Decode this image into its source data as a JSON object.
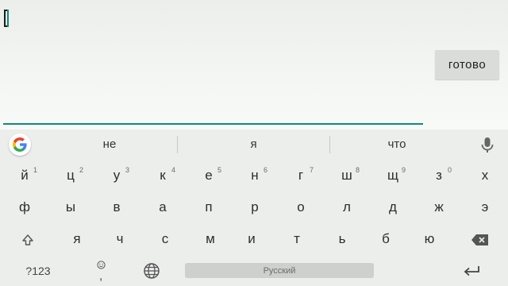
{
  "screen": {
    "done_label": "готово"
  },
  "keyboard": {
    "suggestions": [
      "не",
      "я",
      "что"
    ],
    "row1": [
      {
        "char": "й",
        "hint": "1"
      },
      {
        "char": "ц",
        "hint": "2"
      },
      {
        "char": "у",
        "hint": "3"
      },
      {
        "char": "к",
        "hint": "4"
      },
      {
        "char": "е",
        "hint": "5"
      },
      {
        "char": "н",
        "hint": "6"
      },
      {
        "char": "г",
        "hint": "7"
      },
      {
        "char": "ш",
        "hint": "8"
      },
      {
        "char": "щ",
        "hint": "9"
      },
      {
        "char": "з",
        "hint": "0"
      },
      {
        "char": "х",
        "hint": ""
      }
    ],
    "row2": [
      "ф",
      "ы",
      "в",
      "а",
      "п",
      "р",
      "о",
      "л",
      "д",
      "ж",
      "э"
    ],
    "row3": [
      "я",
      "ч",
      "с",
      "м",
      "и",
      "т",
      "ь",
      "б",
      "ю"
    ],
    "symbols_label": "?123",
    "emoji_key_char": ",",
    "space_label": "Русский",
    "icons": {
      "google": "google-g-icon",
      "mic": "microphone-icon",
      "shift": "shift-arrow-icon",
      "backspace": "backspace-icon",
      "emoji": "smiley-icon",
      "language": "globe-icon",
      "enter": "enter-icon"
    },
    "colors": {
      "accent": "#11897b",
      "key_background": "#eceeec",
      "space_bar": "#cdd0cd"
    }
  }
}
